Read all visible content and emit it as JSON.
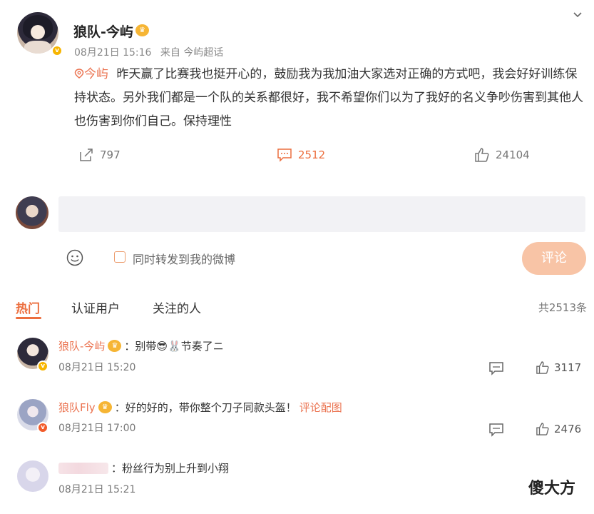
{
  "post": {
    "username": "狼队-今屿",
    "crown_glyph": "♛",
    "verify_glyph": "v",
    "time": "08月21日 15:16",
    "source": "来自 今屿超话",
    "topic": "今屿",
    "text": "昨天赢了比赛我也挺开心的，鼓励我为我加油大家选对正确的方式吧，我会好好训练保持状态。另外我们都是一个队的关系都很好，我不希望你们以为了我好的名义争吵伤害到其他人也伤害到你们自己。保持理性",
    "reposts": "797",
    "comments": "2512",
    "likes": "24104"
  },
  "composer": {
    "repost_label": "同时转发到我的微博",
    "submit_label": "评论"
  },
  "tabs": [
    {
      "label": "热门"
    },
    {
      "label": "认证用户"
    },
    {
      "label": "关注的人"
    }
  ],
  "total_label": "共2513条",
  "comment_list": [
    {
      "name": "狼队-今屿",
      "text": "：别带😎🐰节奏了ニ",
      "time": "08月21日 15:20",
      "likes": "3117"
    },
    {
      "name": "狼队Fly",
      "text": "：好的好的，带你整个刀子同款头盔！",
      "link": "评论配图",
      "time": "08月21日 17:00",
      "likes": "2476"
    },
    {
      "name": "",
      "text": "：粉丝行为别上升到小翔",
      "time": "08月21日 15:21",
      "likes": ""
    }
  ],
  "watermark": "傻大方",
  "colors": {
    "accent": "#ec6e3e",
    "name": "#eb7350",
    "submit_bg": "#f8c4a6",
    "composer_bg": "#f2f2f5"
  }
}
